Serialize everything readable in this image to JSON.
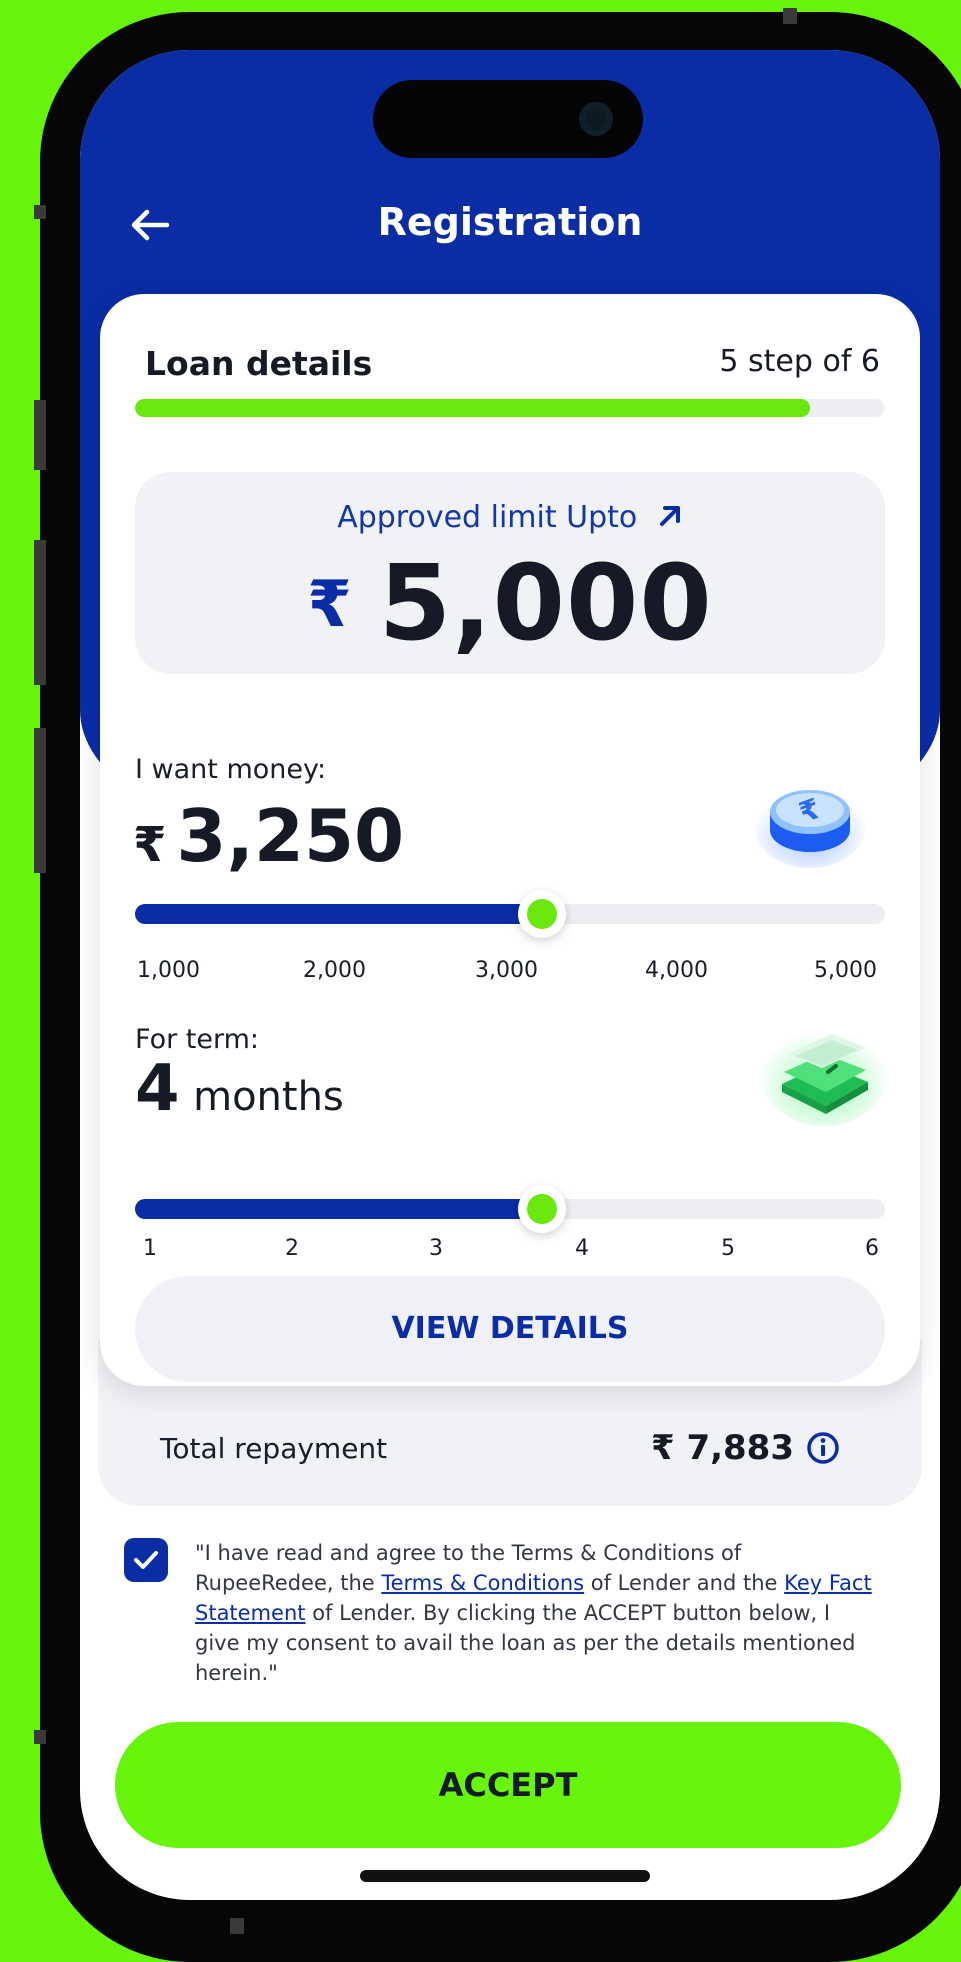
{
  "header": {
    "title": "Registration"
  },
  "loan": {
    "title": "Loan details",
    "step": "5 step of 6",
    "progress_fraction": 0.9
  },
  "limit": {
    "label": "Approved limit Upto",
    "currency": "₹",
    "amount": "5,000"
  },
  "money": {
    "label": "I want money:",
    "currency": "₹",
    "value": "3,250",
    "slider_fraction": 0.542,
    "ticks": [
      "1,000",
      "2,000",
      "3,000",
      "4,000",
      "5,000"
    ]
  },
  "term": {
    "label": "For term:",
    "value": "4",
    "unit": "months",
    "slider_fraction": 0.542,
    "ticks": [
      "1",
      "2",
      "3",
      "4",
      "5",
      "6"
    ]
  },
  "view_details": {
    "label": "VIEW DETAILS"
  },
  "repayment": {
    "label": "Total repayment",
    "value": "₹ 7,883"
  },
  "consent": {
    "checked": true,
    "part1": "\"I have read and agree to the Terms & Conditions of RupeeRedee, the ",
    "link1": "Terms & Conditions",
    "part2": " of Lender and the ",
    "link2": "Key Fact Statement",
    "part3": " of Lender. By clicking the ACCEPT button below, I give my consent to avail the loan as per the details mentioned herein.\""
  },
  "accept": {
    "label": "ACCEPT"
  },
  "colors": {
    "brand_blue": "#0a2da6",
    "accent_green": "#66f50a",
    "progress_green": "#6ae80e"
  }
}
